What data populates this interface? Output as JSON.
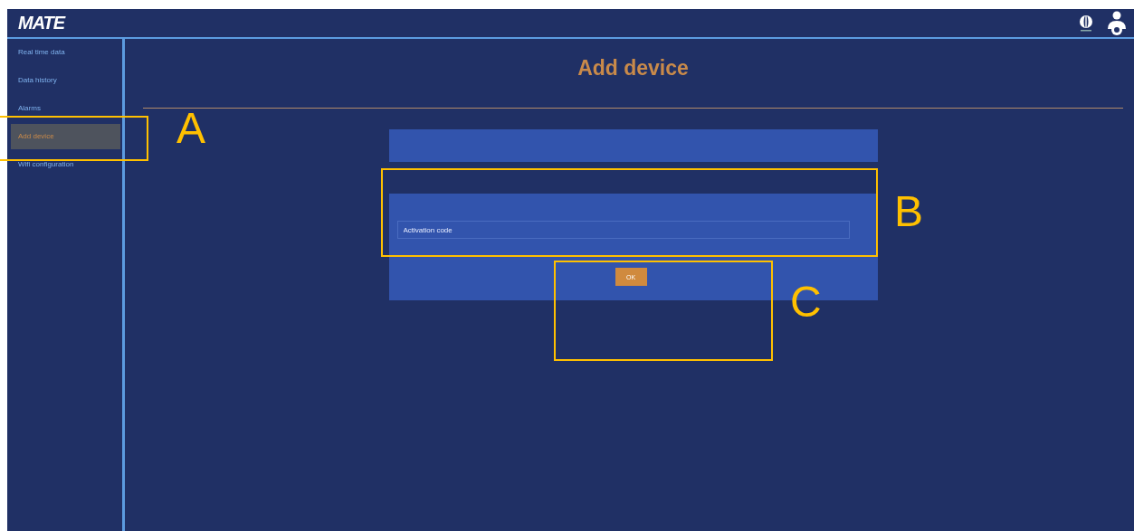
{
  "header": {
    "logo": "MATE"
  },
  "sidebar": {
    "items": [
      {
        "label": "Real time data",
        "selected": false
      },
      {
        "label": "Data history",
        "selected": false
      },
      {
        "label": "Alarms",
        "selected": false
      },
      {
        "label": "Add device",
        "selected": true
      },
      {
        "label": "Wifi configuration",
        "selected": false
      }
    ]
  },
  "main": {
    "title": "Add device",
    "form": {
      "activation_field": {
        "placeholder": "Activation code"
      },
      "ok_button": "OK"
    }
  },
  "annotations": [
    {
      "label": "A"
    },
    {
      "label": "B"
    },
    {
      "label": "C"
    }
  ]
}
